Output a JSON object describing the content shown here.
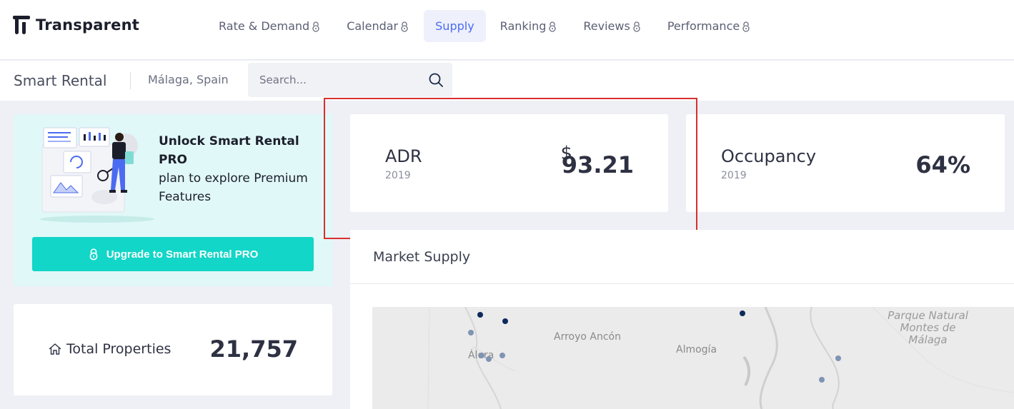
{
  "brand": {
    "name": "Transparent"
  },
  "nav": {
    "items": [
      {
        "label": "Rate & Demand",
        "locked": true
      },
      {
        "label": "Calendar",
        "locked": true
      },
      {
        "label": "Supply",
        "locked": false,
        "active": true
      },
      {
        "label": "Ranking",
        "locked": true
      },
      {
        "label": "Reviews",
        "locked": true
      },
      {
        "label": "Performance",
        "locked": true
      }
    ]
  },
  "subheader": {
    "app_name": "Smart Rental",
    "location": "Málaga, Spain",
    "search_placeholder": "Search..."
  },
  "promo": {
    "headline": "Unlock Smart Rental PRO",
    "body": "plan to explore Premium Features",
    "button_label": "Upgrade to Smart Rental PRO"
  },
  "total_properties": {
    "label": "Total Properties",
    "value": "21,757"
  },
  "kpis": {
    "adr": {
      "title": "ADR",
      "year": "2019",
      "currency": "$",
      "value": "93.21"
    },
    "occupancy": {
      "title": "Occupancy",
      "year": "2019",
      "value": "64%"
    }
  },
  "market": {
    "title": "Market Supply",
    "map_labels": {
      "arroyo": "Arroyo Ancón",
      "almogia": "Almogía",
      "alora": "Álora",
      "parque": "Parque Natural",
      "montes": "Montes de",
      "malaga": "Málaga"
    }
  },
  "colors": {
    "accent": "#4b6cf0",
    "teal": "#12d6c7",
    "highlight": "#d92f2f",
    "dot_dark": "#0e2a5c",
    "dot_light": "#7f93b3"
  }
}
